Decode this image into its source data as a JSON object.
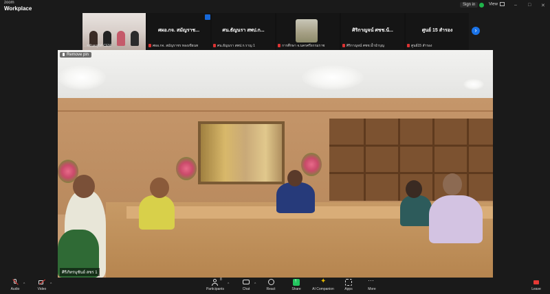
{
  "titlebar": {
    "logo_top": "zoom",
    "logo_bottom": "Workplace",
    "sign_in": "Sign in",
    "view": "View",
    "window_controls": [
      "–",
      "□",
      "✕"
    ]
  },
  "gallery": {
    "tiles": [
      {
        "name": "",
        "label": "...ชยันตภูมิต์ CENI"
      },
      {
        "name": "ศผอ.กจ. สมัญราช...",
        "label": "ศผอ.กจ. สมัญราชร ทองเขียนท"
      },
      {
        "name": "ศน.ธัญนรา สพป.ก...",
        "label": "ศน.ธัญนรา สพป.ก.ราญ 1"
      },
      {
        "name": "",
        "label": "การศึกษา จ.นครศรีธรรมราช"
      },
      {
        "name": "ศิริกาญจน์ ศชช.น้...",
        "label": "ศิริกาญจน์ ศชช.น้ำนำบุญ"
      },
      {
        "name": "ศูนย์ 15 สำรอง",
        "label": "ศูนย์15 สำรอง"
      }
    ],
    "next_icon": "chevron-right-icon"
  },
  "main_video": {
    "remove_pin": "Remove pin",
    "speaker_label": "ศิริภัทรนุชันย์ สชร 1"
  },
  "toolbar": {
    "audio": "Audio",
    "video": "Video",
    "participants": "Participants",
    "participants_count": "8",
    "chat": "Chat",
    "react": "React",
    "share": "Share",
    "ai": "AI Companion",
    "apps": "Apps",
    "more": "More",
    "leave": "Leave"
  },
  "colors": {
    "share_green": "#22c55e",
    "leave_red": "#e53935",
    "accent_blue": "#1a73e8"
  }
}
